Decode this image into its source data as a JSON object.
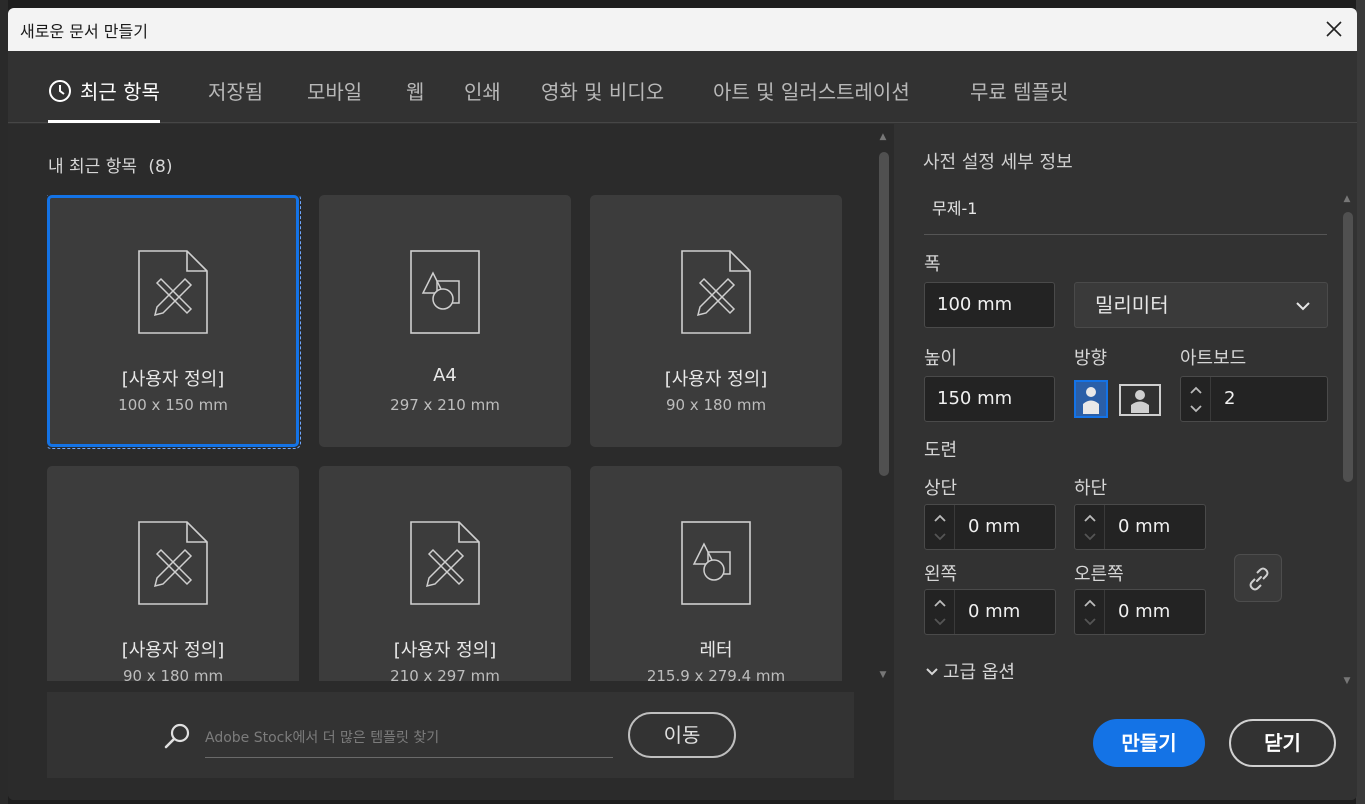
{
  "window": {
    "title": "새로운 문서 만들기"
  },
  "tabs": [
    {
      "label": "최근 항목",
      "icon": "clock-icon",
      "active": true
    },
    {
      "label": "저장됨"
    },
    {
      "label": "모바일"
    },
    {
      "label": "웹"
    },
    {
      "label": "인쇄"
    },
    {
      "label": "영화 및 비디오"
    },
    {
      "label": "아트 및 일러스트레이션"
    },
    {
      "label": "무료 템플릿"
    }
  ],
  "recent": {
    "title": "내 최근 항목",
    "count": "(8)",
    "items": [
      {
        "name": "[사용자 정의]",
        "size": "100 x 150 mm",
        "icon": "ruler-pencil-doc-icon",
        "selected": true
      },
      {
        "name": "A4",
        "size": "297 x 210 mm",
        "icon": "shapes-doc-icon"
      },
      {
        "name": "[사용자 정의]",
        "size": "90 x 180 mm",
        "icon": "ruler-pencil-doc-icon"
      },
      {
        "name": "[사용자 정의]",
        "size": "90 x 180 mm",
        "icon": "ruler-pencil-doc-icon"
      },
      {
        "name": "[사용자 정의]",
        "size": "210 x 297 mm",
        "icon": "ruler-pencil-doc-icon"
      },
      {
        "name": "레터",
        "size": "215.9 x 279.4 mm",
        "icon": "shapes-doc-icon"
      }
    ]
  },
  "stock": {
    "placeholder": "Adobe Stock에서 더 많은 템플릿 찾기",
    "go_label": "이동"
  },
  "preset": {
    "heading": "사전 설정 세부 정보",
    "doc_name": "무제-1",
    "width_label": "폭",
    "width_value": "100 mm",
    "unit_value": "밀리미터",
    "height_label": "높이",
    "height_value": "150 mm",
    "orientation_label": "방향",
    "orientation_selected": "portrait",
    "artboards_label": "아트보드",
    "artboards_value": "2",
    "bleed_label": "도련",
    "bleed": {
      "top_label": "상단",
      "top_value": "0 mm",
      "bottom_label": "하단",
      "bottom_value": "0 mm",
      "left_label": "왼쪽",
      "left_value": "0 mm",
      "right_label": "오른쪽",
      "right_value": "0 mm"
    },
    "advanced_label": "고급 옵션"
  },
  "actions": {
    "create_label": "만들기",
    "close_label": "닫기"
  },
  "colors": {
    "accent": "#1473e6",
    "panel": "#323232",
    "cards": "#3c3c3c"
  }
}
